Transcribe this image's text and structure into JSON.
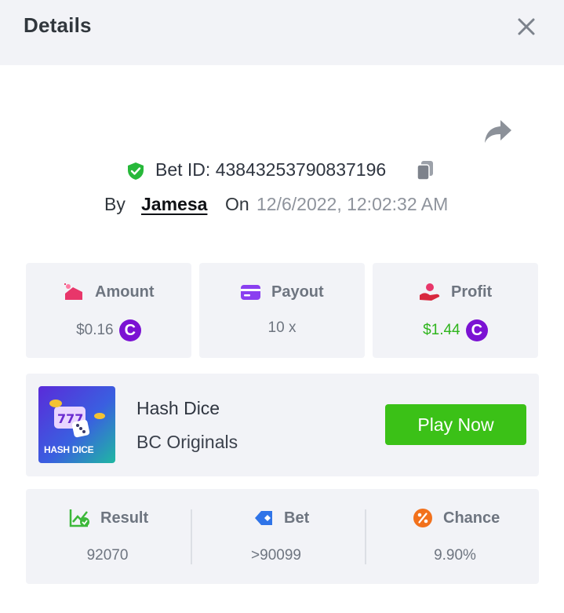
{
  "header": {
    "title": "Details"
  },
  "bet": {
    "id_label": "Bet ID: 43843253790837196",
    "by_label": "By",
    "username": "Jamesa",
    "on_label": "On",
    "date": "12/6/2022, 12:02:32 AM"
  },
  "stats": [
    {
      "label": "Amount",
      "value": "$0.16",
      "icon": "amount-icon",
      "color": "#6e7580"
    },
    {
      "label": "Payout",
      "value": "10 x",
      "icon": "payout-icon",
      "color": "#6e7580"
    },
    {
      "label": "Profit",
      "value": "$1.44",
      "icon": "profit-icon",
      "color": "#2fb51d"
    }
  ],
  "game": {
    "name": "Hash Dice",
    "provider": "BC Originals",
    "thumb_text": "HASH DICE",
    "play_label": "Play Now"
  },
  "results": [
    {
      "label": "Result",
      "value": "92070",
      "icon": "result-chart-icon"
    },
    {
      "label": "Bet",
      "value": ">90099",
      "icon": "bet-target-icon"
    },
    {
      "label": "Chance",
      "value": "9.90%",
      "icon": "percent-icon"
    }
  ],
  "coin_symbol": "C",
  "colors": {
    "accent_green": "#3bc117",
    "profit_green": "#2fb51d",
    "coin_purple": "#7b12d3",
    "panel_bg": "#f2f3f7"
  }
}
